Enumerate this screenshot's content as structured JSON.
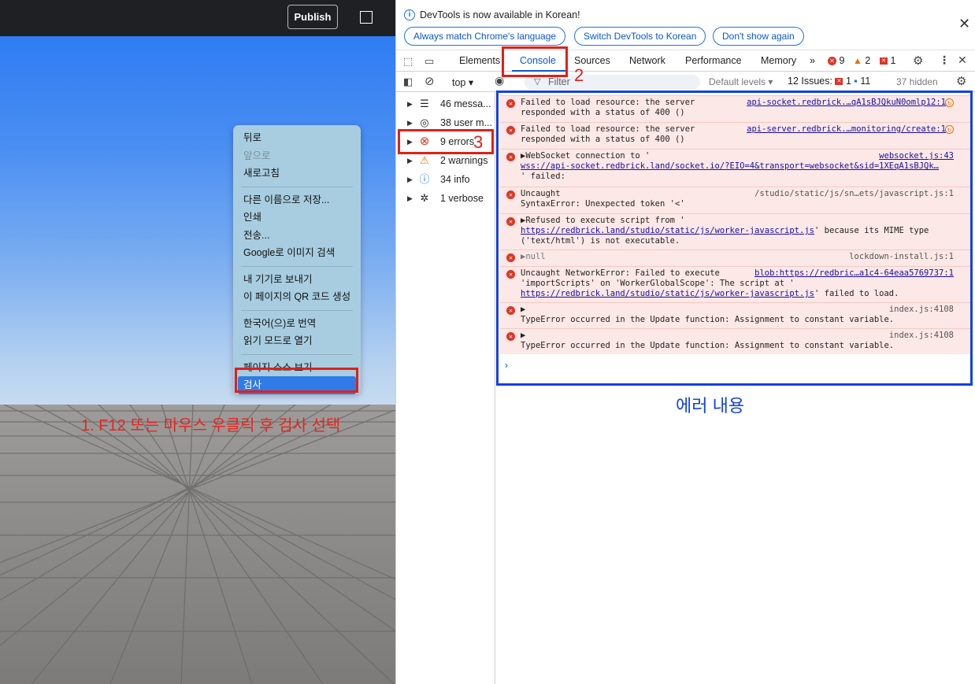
{
  "app": {
    "publish_label": "Publish"
  },
  "context_menu": {
    "items": [
      {
        "label": "뒤로",
        "disabled": false
      },
      {
        "label": "앞으로",
        "disabled": true
      },
      {
        "label": "새로고침",
        "disabled": false
      },
      {
        "sep": true
      },
      {
        "label": "다른 이름으로 저장...",
        "disabled": false
      },
      {
        "label": "인쇄",
        "disabled": false
      },
      {
        "label": "전송...",
        "disabled": false
      },
      {
        "label": "Google로 이미지 검색",
        "disabled": false
      },
      {
        "sep": true
      },
      {
        "label": "내 기기로 보내기",
        "disabled": false
      },
      {
        "label": "이 페이지의 QR 코드 생성",
        "disabled": false
      },
      {
        "sep": true
      },
      {
        "label": "한국어(으)로 번역",
        "disabled": false
      },
      {
        "label": "읽기 모드로 열기",
        "disabled": false
      },
      {
        "sep": true
      },
      {
        "label": "페이지 소스 보기",
        "disabled": false
      },
      {
        "label": "검사",
        "disabled": false,
        "active": true
      }
    ]
  },
  "annotations": {
    "step1": "1. F12 또는 마우스 우클릭 후 검사 선택",
    "step2": "2",
    "step3": "3",
    "error_content": "에러 내용"
  },
  "devtools": {
    "notice": {
      "text": "DevTools is now available in Korean!",
      "buttons": [
        "Always match Chrome's language",
        "Switch DevTools to Korean",
        "Don't show again"
      ]
    },
    "tabs": [
      "Elements",
      "Console",
      "Sources",
      "Network",
      "Performance",
      "Memory"
    ],
    "active_tab": "Console",
    "counts": {
      "errors": "9",
      "warnings": "2",
      "issues": "1"
    },
    "toolbar": {
      "context": "top",
      "filter_placeholder": "Filter",
      "levels": "Default levels",
      "issues_label": "12 Issues:",
      "issues_errors": "1",
      "issues_info": "11",
      "hidden": "37 hidden"
    },
    "sidebar": [
      {
        "label": "46 messa...",
        "icon": "list-icon"
      },
      {
        "label": "38 user m...",
        "icon": "user-icon"
      },
      {
        "label": "9 errors",
        "icon": "error-icon"
      },
      {
        "label": "2 warnings",
        "icon": "warning-icon"
      },
      {
        "label": "34 info",
        "icon": "info-icon"
      },
      {
        "label": "1 verbose",
        "icon": "bug-icon"
      }
    ],
    "messages": {
      "m1": {
        "line1": "Failed to load resource: the server",
        "line2": "responded with a status of 400 ()",
        "src": "api-socket.redbrick.…qA1sBJQkuN0omlp12:1"
      },
      "m2": {
        "line1": "Failed to load resource: the server",
        "line2": "responded with a status of 400 ()",
        "src": "api-server.redbrick.…monitoring/create:1"
      },
      "m3": {
        "line1": "▶WebSocket connection to '",
        "line2": "wss://api-socket.redbrick.land/socket.io/?EIO=4&transport=websocket&sid=1XEqA1sBJQk…",
        "line3": "' failed:",
        "src": "websocket.js:43"
      },
      "m4": {
        "line1": "Uncaught",
        "line2": "SyntaxError: Unexpected token '<'",
        "src": "/studio/static/js/sn…ets/javascript.js:1"
      },
      "m5": {
        "line1": "▶Refused to execute script from '",
        "link": "https://redbrick.land/studio/static/js/worker-javascript.js",
        "after": "' because its MIME type",
        "line3": "('text/html') is not executable."
      },
      "m6": {
        "line1": "▶null",
        "src": "lockdown-install.js:1"
      },
      "m7": {
        "line1": "Uncaught NetworkError: Failed to execute",
        "line2": "'importScripts' on 'WorkerGlobalScope': The script at '",
        "link": "https://redbrick.land/studio/static/js/worker-javascript.js",
        "after": "' failed to load.",
        "src": "blob:https://redbric…a1c4-64eaa5769737:1"
      },
      "m8": {
        "line1": "▶",
        "line2": "TypeError occurred in the Update function: Assignment to constant variable.",
        "src": "index.js:4108"
      },
      "m9": {
        "line1": "▶",
        "line2": "TypeError occurred in the Update function: Assignment to constant variable.",
        "src": "index.js:4108"
      }
    }
  }
}
